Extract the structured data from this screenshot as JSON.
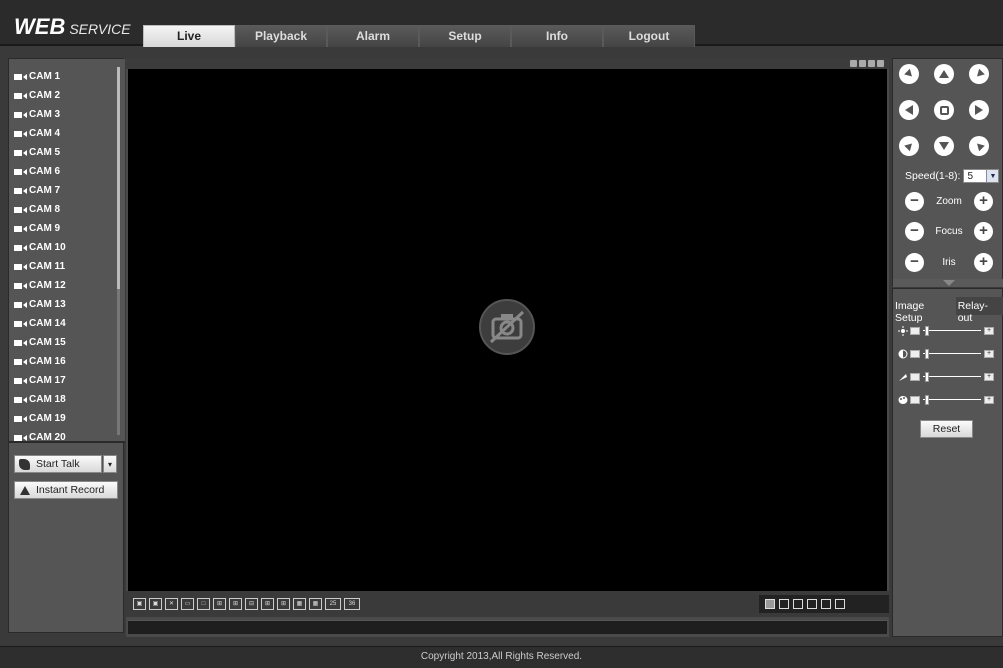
{
  "header": {
    "logo_main": "WEB",
    "logo_sub": "SERVICE",
    "tabs": [
      {
        "label": "Live"
      },
      {
        "label": "Playback"
      },
      {
        "label": "Alarm"
      },
      {
        "label": "Setup"
      },
      {
        "label": "Info"
      },
      {
        "label": "Logout"
      }
    ],
    "active_tab": "Live"
  },
  "channels": [
    "CAM 1",
    "CAM 2",
    "CAM 3",
    "CAM 4",
    "CAM 5",
    "CAM 6",
    "CAM 7",
    "CAM 8",
    "CAM 9",
    "CAM 10",
    "CAM 11",
    "CAM 12",
    "CAM 13",
    "CAM 14",
    "CAM 15",
    "CAM 16",
    "CAM 17",
    "CAM 18",
    "CAM 19",
    "CAM 20"
  ],
  "left_panel": {
    "start_talk_label": "Start Talk",
    "instant_record_label": "Instant Record",
    "talk_dropdown_arrow": "▾"
  },
  "split_modes": [
    "1",
    "4",
    "8",
    "9",
    "16",
    "25",
    "36"
  ],
  "ptz": {
    "speed_label": "Speed(1-8):",
    "speed_value": "5",
    "zoom_label": "Zoom",
    "focus_label": "Focus",
    "iris_label": "Iris"
  },
  "image_setup": {
    "tab_image": "Image Setup",
    "tab_relay": "Relay-out",
    "sliders": [
      {
        "name": "brightness",
        "icon": "sun-icon"
      },
      {
        "name": "contrast",
        "icon": "contrast-icon"
      },
      {
        "name": "saturation",
        "icon": "saturation-icon"
      },
      {
        "name": "hue",
        "icon": "palette-icon"
      }
    ],
    "reset_label": "Reset"
  },
  "footer": {
    "copyright": "Copyright 2013,All Rights Reserved."
  }
}
